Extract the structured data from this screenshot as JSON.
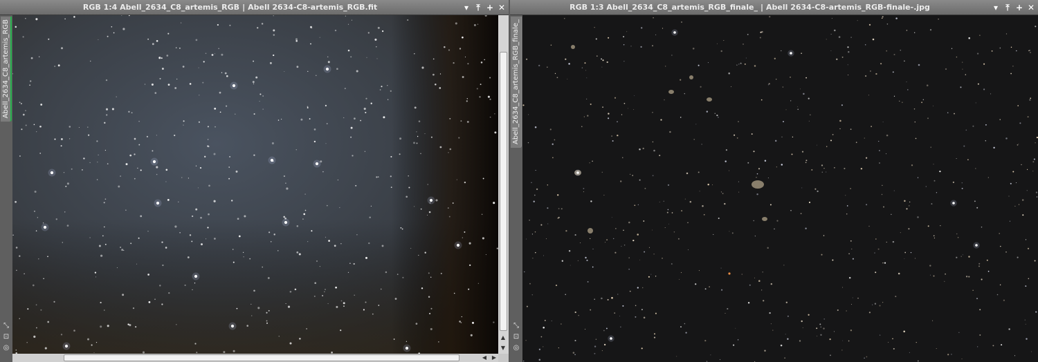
{
  "windows": [
    {
      "title_prefix": "RGB 1:4 Abell_2634_C8_artemis_RGB",
      "title_sep": "|",
      "title_file": "Abell 2634-C8-artemis_RGB.fit",
      "side_tab": "Abell_2634_C8_artemis_RGB"
    },
    {
      "title_prefix": "RGB 1:3 Abell_2634_C8_artemis_RGB_finale_",
      "title_sep": "|",
      "title_file": "Abell 2634-C8-artemis_RGB-finale-.jpg",
      "side_tab": "Abell_2634_C8_artemis_RGB_finale_"
    }
  ],
  "window_controls": {
    "shade": "▾",
    "minimize": "⤒",
    "maximize": "+",
    "close": "✕"
  },
  "side_tools": {
    "fit": "⤡",
    "zoom": "⊡",
    "view": "◎"
  },
  "scroll_arrows": {
    "up": "▲",
    "down": "▼",
    "left": "◀",
    "right": "▶"
  },
  "icons": [
    "shade-icon",
    "minimize-icon",
    "maximize-icon",
    "close-icon",
    "fit-icon",
    "zoom-icon",
    "view-icon"
  ],
  "colors": {
    "titlebar": "#7a7a7a",
    "active_tab": "#25b04c",
    "sky_left": "#3a4048",
    "sky_right": "#151516"
  }
}
